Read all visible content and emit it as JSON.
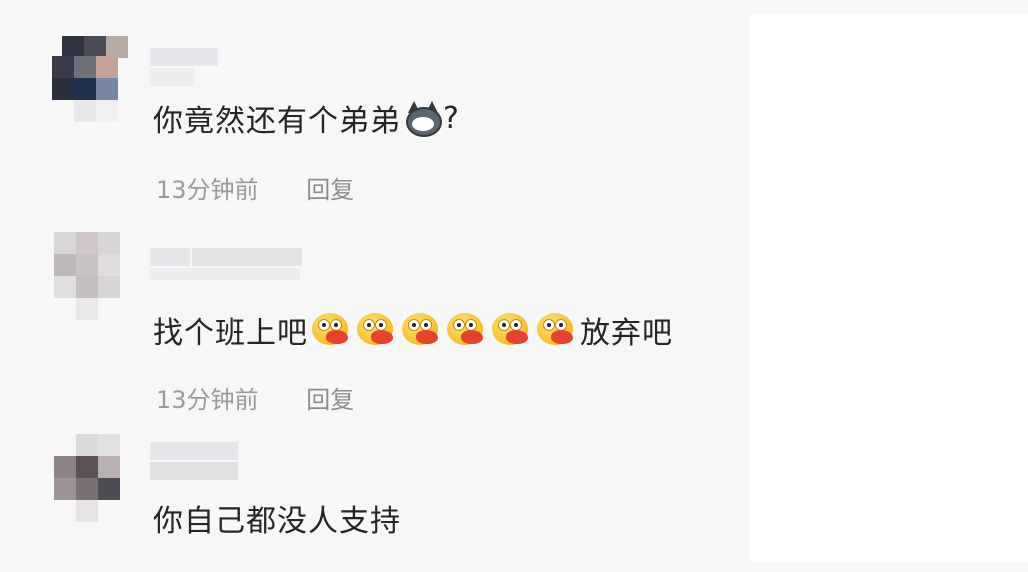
{
  "comments": [
    {
      "text_before": "你竟然还有个弟弟",
      "emoji": "husky-dog-emoji",
      "text_after": "?",
      "time": "13分钟前",
      "reply": "回复"
    },
    {
      "text_before": "找个班上吧",
      "emoji": "duck-emoji",
      "emoji_count": 6,
      "text_after": "放弃吧",
      "time": "13分钟前",
      "reply": "回复"
    },
    {
      "text_before": "你自己都没人支持",
      "text_after": ""
    }
  ],
  "colors": {
    "text": "#252525",
    "meta": "#9a9a9a",
    "panel": "#f7f7f7"
  }
}
